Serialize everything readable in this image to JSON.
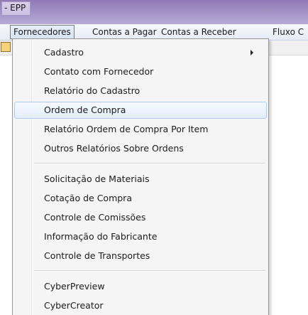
{
  "window": {
    "title": "- EPP"
  },
  "menubar": {
    "items": [
      "Fornecedores",
      "Contas a Pagar",
      "Contas a Receber",
      "Fluxo C"
    ]
  },
  "dropdown": {
    "items": [
      "Cadastro",
      "Contato com Fornecedor",
      "Relatório do Cadastro",
      "Ordem de Compra",
      "Relatório Ordem de Compra Por Item",
      "Outros Relatórios Sobre Ordens",
      "Solicitação de Materiais",
      "Cotação de Compra",
      "Controle de Comissões",
      "Informação do Fabricante",
      "Controle de Transportes",
      "CyberPreview",
      "CyberCreator"
    ],
    "hovered_item": "Ordem de Compra",
    "submenu_item": "Cadastro"
  }
}
